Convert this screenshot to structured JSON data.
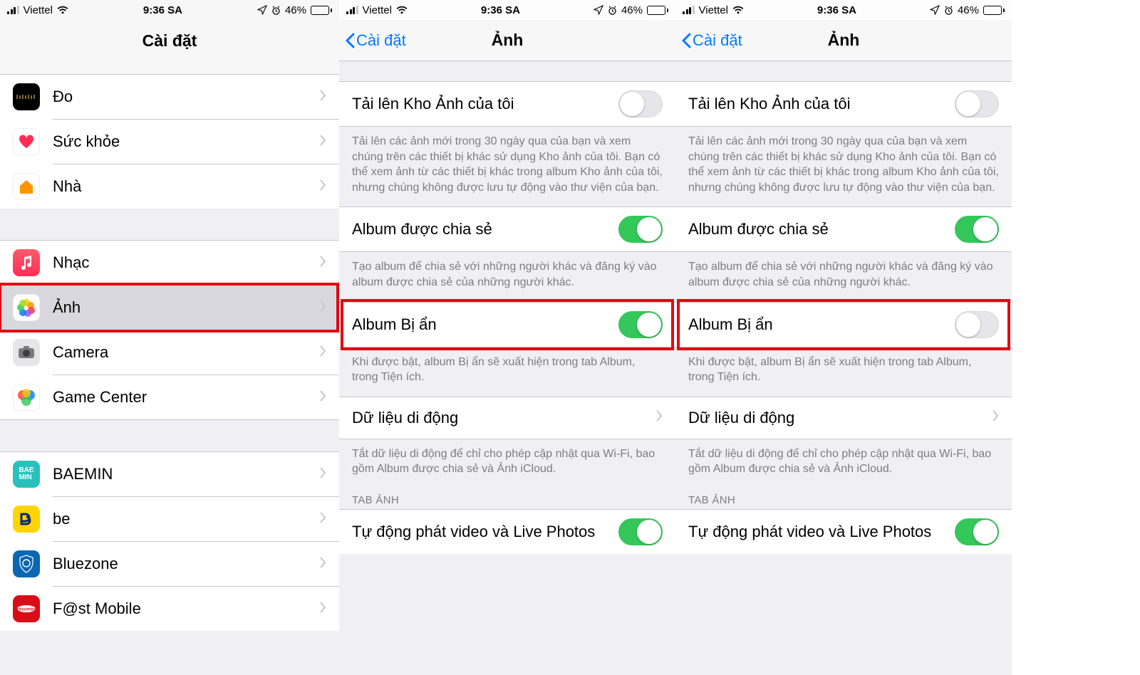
{
  "status": {
    "carrier": "Viettel",
    "time": "9:36 SA",
    "battery_pct": "46%"
  },
  "p1": {
    "title": "Cài đặt",
    "items": {
      "do": "Đo",
      "health": "Sức khỏe",
      "home": "Nhà",
      "music": "Nhạc",
      "photos": "Ảnh",
      "camera": "Camera",
      "gamecenter": "Game Center",
      "baemin": "BAEMIN",
      "be": "be",
      "bluezone": "Bluezone",
      "fast": "F@st Mobile"
    }
  },
  "photos": {
    "back": "Cài đặt",
    "title": "Ảnh",
    "upload_label": "Tải lên Kho Ảnh của tôi",
    "upload_foot": "Tải lên các ảnh mới trong 30 ngày qua của bạn và xem chúng trên các thiết bị khác sử dụng Kho ảnh của tôi. Bạn có thể xem ảnh từ các thiết bị khác trong album Kho ảnh của tôi, nhưng chúng không được lưu tự động vào thư viện của bạn.",
    "shared_label": "Album được chia sẻ",
    "shared_foot": "Tạo album để chia sẻ với những người khác và đăng ký vào album được chia sẻ của những người khác.",
    "hidden_label": "Album Bị ẩn",
    "hidden_foot": "Khi được bật, album Bị ẩn sẽ xuất hiện trong tab Album, trong Tiện ích.",
    "cell_label": "Dữ liệu di động",
    "cell_foot": "Tắt dữ liệu di động để chỉ cho phép cập nhật qua Wi-Fi, bao gồm Album được chia sẻ và Ảnh iCloud.",
    "tab_header": "TAB ẢNH",
    "autoplay_label": "Tự động phát video và Live Photos"
  },
  "toggles": {
    "p2": {
      "upload": false,
      "shared": true,
      "hidden": true,
      "autoplay": true
    },
    "p3": {
      "upload": false,
      "shared": true,
      "hidden": false,
      "autoplay": true
    }
  }
}
